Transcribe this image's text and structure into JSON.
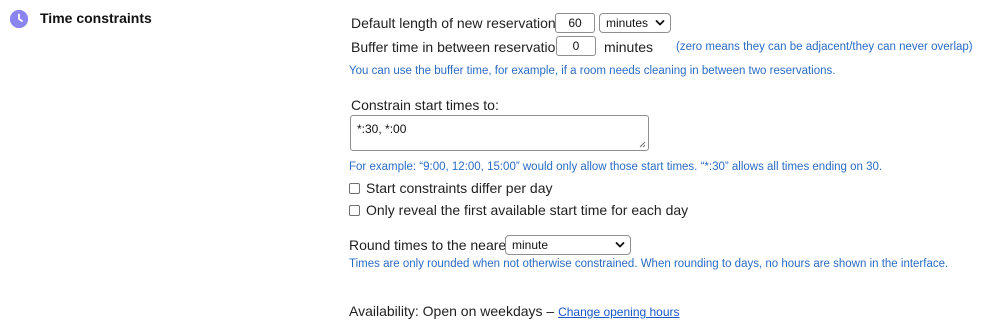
{
  "section": {
    "title": "Time constraints",
    "icon": "clock-icon",
    "accent_color": "#8a84f0"
  },
  "default_length": {
    "label": "Default length of new reservations",
    "value": "60",
    "unit_selected": "minutes"
  },
  "buffer_time": {
    "label": "Buffer time in between reservations",
    "value": "0",
    "unit": "minutes",
    "note": "(zero means they can be adjacent/they can never overlap)"
  },
  "buffer_hint": "You can use the buffer time, for example, if a room needs cleaning in between two reservations.",
  "start_times": {
    "label": "Constrain start times to:",
    "value": "*:30, *:00",
    "hint": "For example: “9:00, 12:00, 15:00” would only allow those start times. “*:30” allows all times ending on 30."
  },
  "checkboxes": [
    {
      "label": "Start constraints differ per day",
      "checked": false
    },
    {
      "label": "Only reveal the first available start time for each day",
      "checked": false
    }
  ],
  "rounding": {
    "label": "Round times to the nearest",
    "selected": "minute",
    "hint": "Times are only rounded when not otherwise constrained. When rounding to days, no hours are shown in the interface."
  },
  "availability": {
    "label": "Availability: Open on weekdays –",
    "link": "Change opening hours"
  },
  "colors": {
    "hint_text": "#2b6cc4",
    "link": "#1a56c8"
  }
}
